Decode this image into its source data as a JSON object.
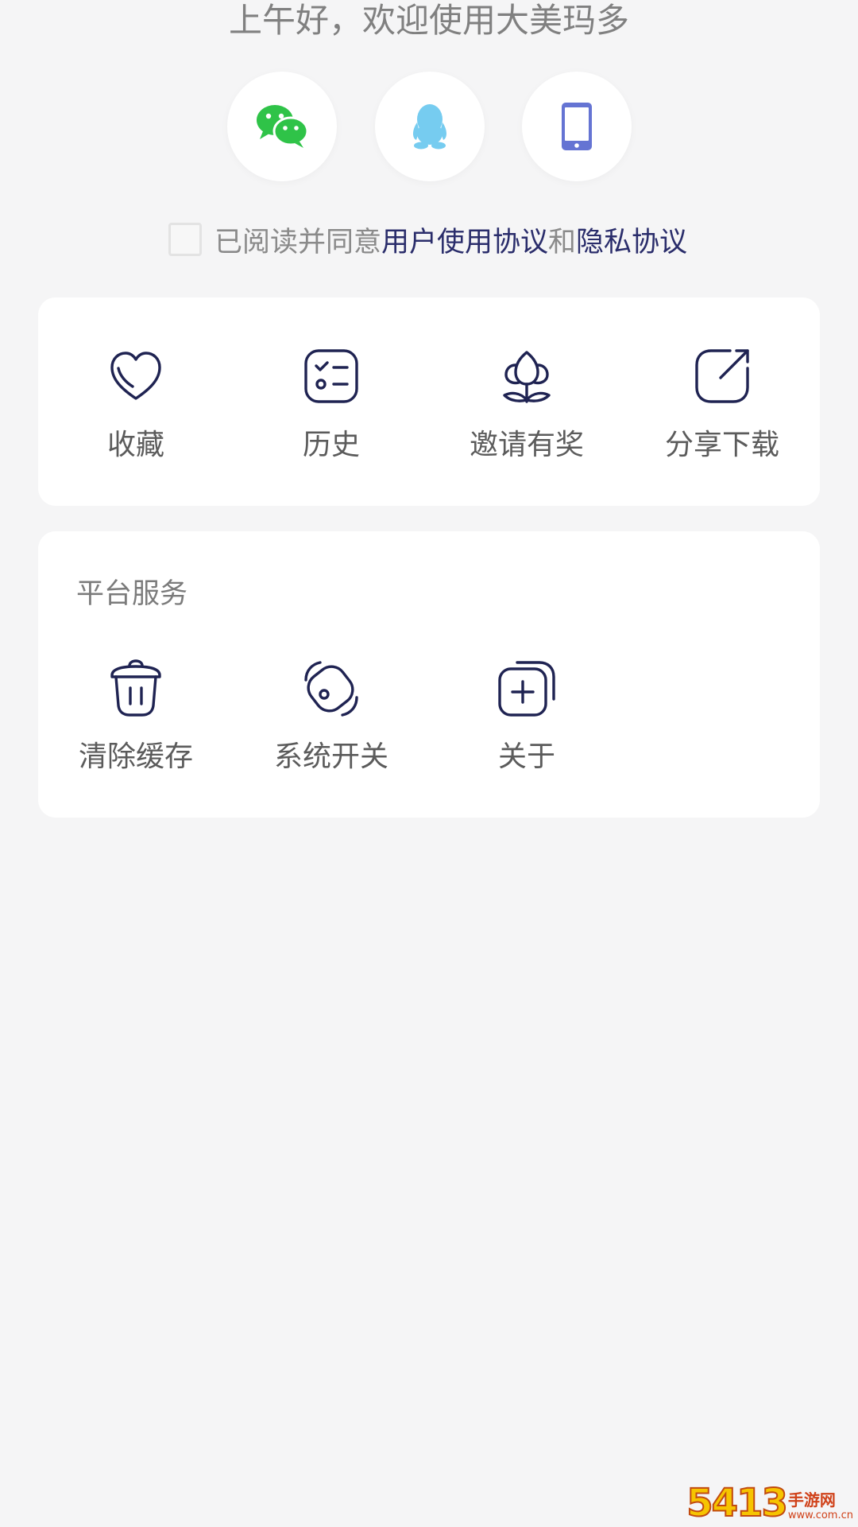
{
  "greeting": "上午好，欢迎使用大美玛多",
  "login_options": [
    {
      "name": "wechat",
      "icon": "wechat-icon",
      "color": "#2fc348"
    },
    {
      "name": "qq",
      "icon": "qq-penguin-icon",
      "color": "#76ccf0"
    },
    {
      "name": "phone",
      "icon": "phone-icon",
      "color": "#6574d3"
    }
  ],
  "agreement": {
    "prefix": "已阅读并同意",
    "user_agreement": "用户使用协议",
    "conjunction": "和",
    "privacy_agreement": "隐私协议",
    "checked": false
  },
  "quick_actions": [
    {
      "label": "收藏",
      "icon": "heart-icon"
    },
    {
      "label": "历史",
      "icon": "checklist-icon"
    },
    {
      "label": "邀请有奖",
      "icon": "flower-icon"
    },
    {
      "label": "分享下载",
      "icon": "share-icon"
    }
  ],
  "platform_services": {
    "title": "平台服务",
    "items": [
      {
        "label": "清除缓存",
        "icon": "trash-icon"
      },
      {
        "label": "系统开关",
        "icon": "toggle-icon"
      },
      {
        "label": "关于",
        "icon": "about-plus-icon"
      }
    ]
  },
  "colors": {
    "background": "#f5f5f6",
    "card": "#ffffff",
    "icon_stroke": "#1f2352",
    "link": "#2a2d6b",
    "label": "#5b5b5b"
  },
  "watermark": {
    "number": "5413",
    "text": "手游网",
    "url": "www.com.cn"
  }
}
